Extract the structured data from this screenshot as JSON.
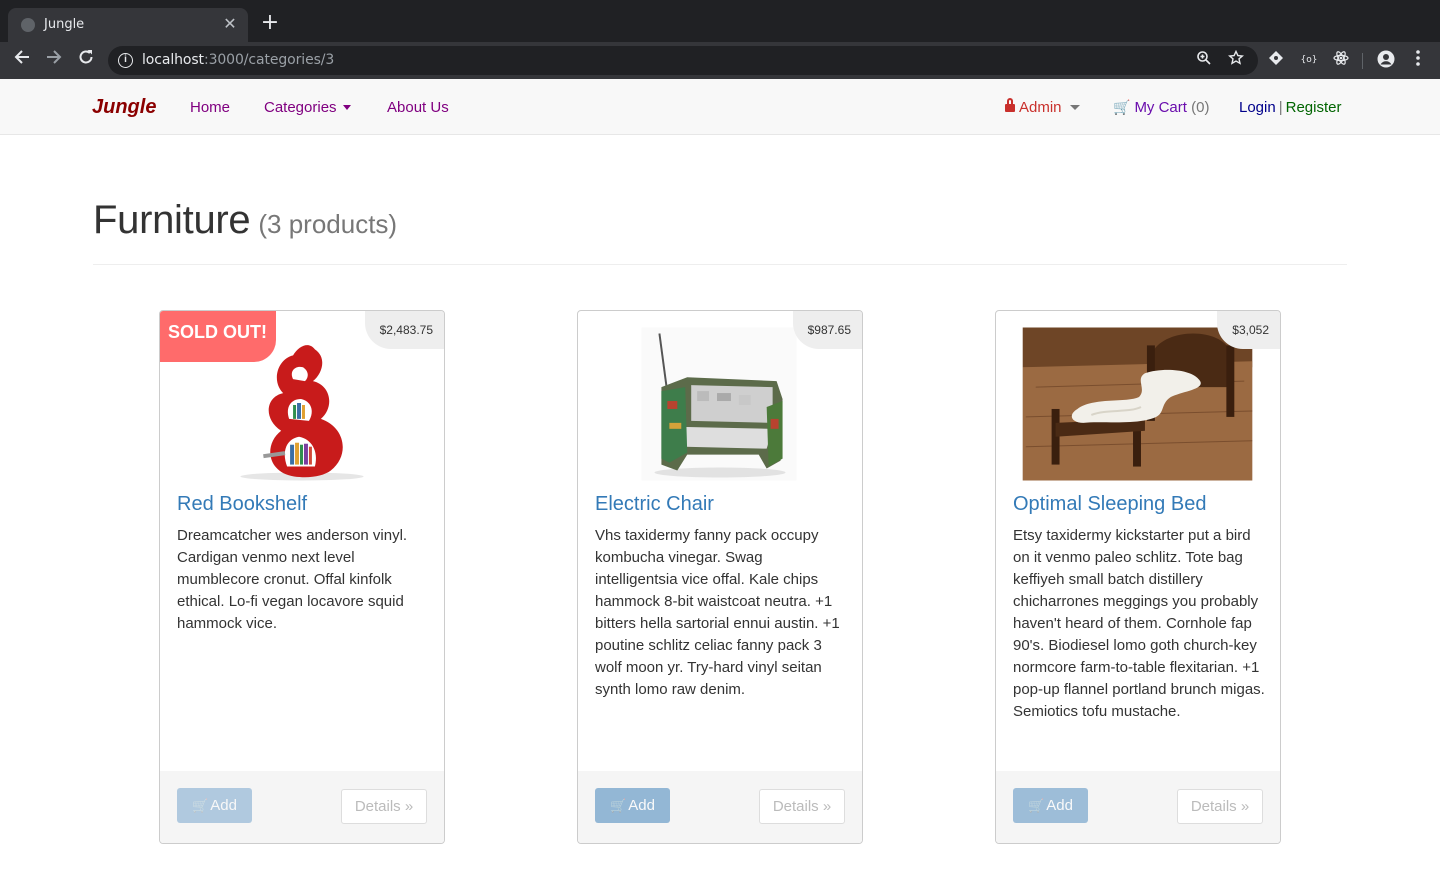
{
  "browser": {
    "tab_title": "Jungle",
    "tab_close": "✕",
    "new_tab": "+",
    "url_host": "localhost",
    "url_path": ":3000/categories/3",
    "info_glyph": "i"
  },
  "navbar": {
    "brand": "Jungle",
    "links": {
      "home": "Home",
      "categories": "Categories",
      "about": "About Us"
    },
    "admin": "Admin",
    "cart_label": "My Cart",
    "cart_count": "(0)",
    "login": "Login",
    "separator": "|",
    "register": "Register"
  },
  "page": {
    "title": "Furniture",
    "subtitle": "(3 products)"
  },
  "products": [
    {
      "name": "Red Bookshelf",
      "price": "$2,483.75",
      "sold_out": "SOLD OUT!",
      "description": "Dreamcatcher wes anderson vinyl. Cardigan venmo next level mumblecore cronut. Offal kinfolk ethical. Lo-fi vegan locavore squid hammock vice.",
      "add_label": "Add",
      "details_label": "Details »"
    },
    {
      "name": "Electric Chair",
      "price": "$987.65",
      "description": "Vhs taxidermy fanny pack occupy kombucha vinegar. Swag intelligentsia vice offal. Kale chips hammock 8-bit waistcoat neutra. +1 bitters hella sartorial ennui austin. +1 poutine schlitz celiac fanny pack 3 wolf moon yr. Try-hard vinyl seitan synth lomo raw denim.",
      "add_label": "Add",
      "details_label": "Details »"
    },
    {
      "name": "Optimal Sleeping Bed",
      "price": "$3,052",
      "description": "Etsy taxidermy kickstarter put a bird on it venmo paleo schlitz. Tote bag keffiyeh small batch distillery chicharrones meggings you probably haven't heard of them. Cornhole fap 90's. Biodiesel lomo goth church-key normcore farm-to-table flexitarian. +1 pop-up flannel portland brunch migas. Semiotics tofu mustache.",
      "add_label": "Add",
      "details_label": "Details »"
    }
  ]
}
